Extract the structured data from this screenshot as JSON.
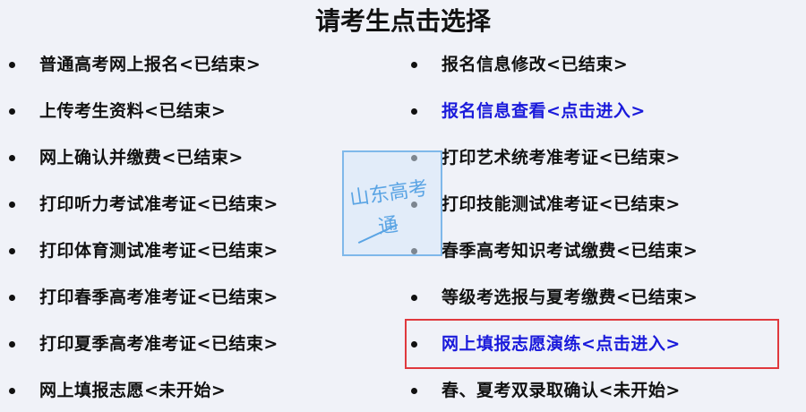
{
  "page": {
    "title": "请考生点击选择"
  },
  "left_items": [
    {
      "label": "普通高考网上报名<已结束>",
      "link": false
    },
    {
      "label": "上传考生资料<已结束>",
      "link": false
    },
    {
      "label": "网上确认并缴费<已结束>",
      "link": false
    },
    {
      "label": "打印听力考试准考证<已结束>",
      "link": false
    },
    {
      "label": "打印体育测试准考证<已结束>",
      "link": false
    },
    {
      "label": "打印春季高考准考证<已结束>",
      "link": false
    },
    {
      "label": "打印夏季高考准考证<已结束>",
      "link": false
    },
    {
      "label": "网上填报志愿<未开始>",
      "link": false
    }
  ],
  "right_items": [
    {
      "label": "报名信息修改<已结束>",
      "link": false
    },
    {
      "label": "报名信息查看<点击进入>",
      "link": true
    },
    {
      "label": "打印艺术统考准考证<已结束>",
      "link": false
    },
    {
      "label": "打印技能测试准考证<已结束>",
      "link": false
    },
    {
      "label": "春季高考知识考试缴费<已结束>",
      "link": false
    },
    {
      "label": "等级考选报与夏考缴费<已结束>",
      "link": false
    },
    {
      "label": "网上填报志愿演练<点击进入>",
      "link": true,
      "highlighted": true
    },
    {
      "label": "春、夏考双录取确认<未开始>",
      "link": false
    }
  ],
  "watermark": {
    "line1": "山东高考",
    "line2": "通"
  },
  "colors": {
    "link": "#1a1adb",
    "text": "#111111",
    "background": "#f0f2f8",
    "highlight_border": "#e0393e",
    "watermark": "#5aa4e4"
  }
}
